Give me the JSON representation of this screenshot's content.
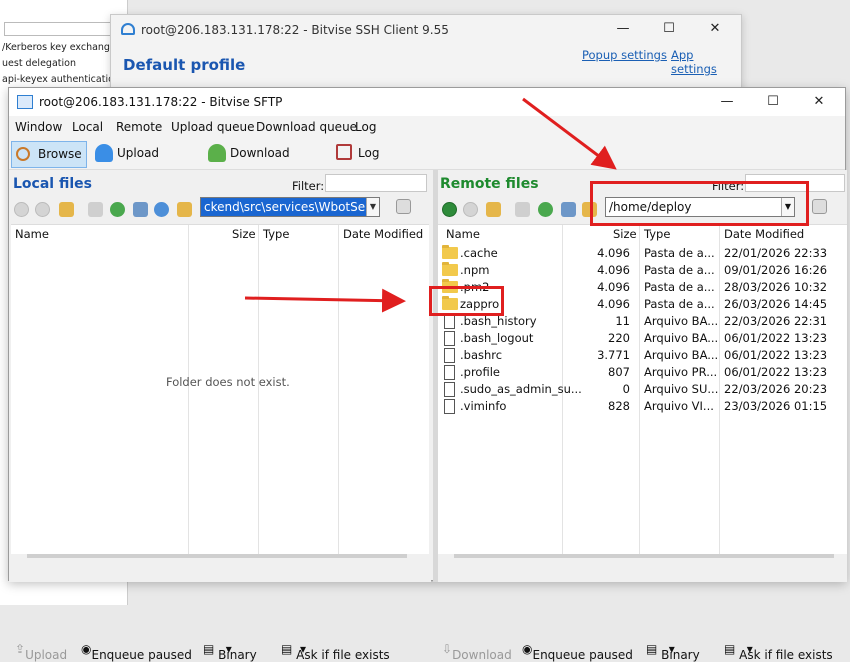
{
  "bg": {
    "lines": [
      "/Kerberos key exchange",
      "uest delegation",
      "api-keyex authentication"
    ]
  },
  "ssh": {
    "title": "root@206.183.131.178:22 - Bitvise SSH Client 9.55",
    "popup": "Popup settings",
    "app": "App settings",
    "profile": "Default profile"
  },
  "sftp": {
    "title": "root@206.183.131.178:22 - Bitvise SFTP",
    "minimize": "—",
    "maximize": "☐",
    "close": "✕"
  },
  "menu": [
    "Window",
    "Local",
    "Remote",
    "Upload queue",
    "Download queue",
    "Log"
  ],
  "toolbar": {
    "browse": "Browse",
    "upload_queue": "Upload queue",
    "download_queue": "Download queue",
    "log": "Log"
  },
  "local": {
    "title": "Local files",
    "filter": "Filter:",
    "path": "ckend\\src\\services\\WbotServices",
    "cols": [
      "Name",
      "Size",
      "Type",
      "Date Modified"
    ],
    "empty": "Folder does not exist.",
    "upload": "Upload",
    "enqueue": "Enqueue paused",
    "binary": "Binary",
    "ask": "Ask if file exists"
  },
  "remote": {
    "title": "Remote files",
    "filter": "Filter:",
    "path": "/home/deploy",
    "cols": [
      "Name",
      "Size",
      "Type",
      "Date Modified"
    ],
    "download": "Download",
    "enqueue": "Enqueue paused",
    "binary": "Binary",
    "ask": "Ask if file exists",
    "files": [
      {
        "name": ".cache",
        "size": "4.096",
        "type": "Pasta de a...",
        "date": "22/01/2026 22:33",
        "folder": true
      },
      {
        "name": ".npm",
        "size": "4.096",
        "type": "Pasta de a...",
        "date": "09/01/2026 16:26",
        "folder": true
      },
      {
        "name": ".pm2",
        "size": "4.096",
        "type": "Pasta de a...",
        "date": "28/03/2026 10:32",
        "folder": true
      },
      {
        "name": "zappro",
        "size": "4.096",
        "type": "Pasta de a...",
        "date": "26/03/2026 14:45",
        "folder": true
      },
      {
        "name": ".bash_history",
        "size": "11",
        "type": "Arquivo BA...",
        "date": "22/03/2026 22:31",
        "folder": false
      },
      {
        "name": ".bash_logout",
        "size": "220",
        "type": "Arquivo BA...",
        "date": "06/01/2022 13:23",
        "folder": false
      },
      {
        "name": ".bashrc",
        "size": "3.771",
        "type": "Arquivo BA...",
        "date": "06/01/2022 13:23",
        "folder": false
      },
      {
        "name": ".profile",
        "size": "807",
        "type": "Arquivo PR...",
        "date": "06/01/2022 13:23",
        "folder": false
      },
      {
        "name": ".sudo_as_admin_su...",
        "size": "0",
        "type": "Arquivo SU...",
        "date": "22/03/2026 20:23",
        "folder": false
      },
      {
        "name": ".viminfo",
        "size": "828",
        "type": "Arquivo VI...",
        "date": "23/03/2026 01:15",
        "folder": false
      }
    ]
  },
  "colors": {
    "accent": "#1a56b0",
    "remote_title": "#1e8a2e",
    "annotation": "#e01f1f"
  }
}
